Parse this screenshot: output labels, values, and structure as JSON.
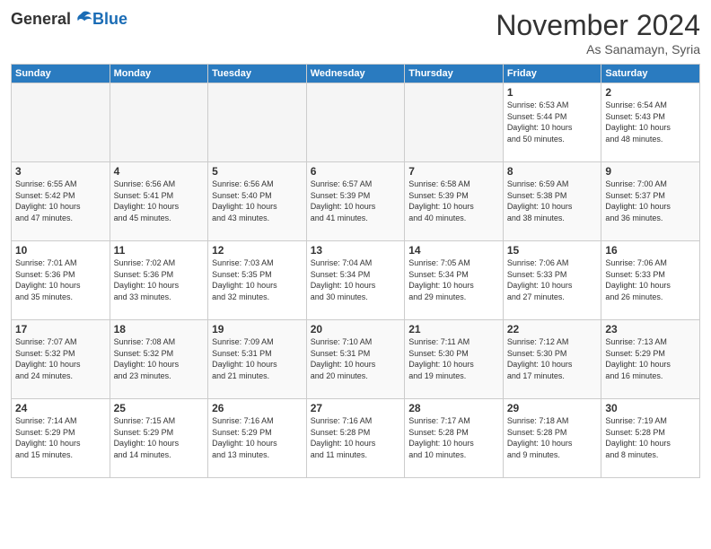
{
  "header": {
    "logo_general": "General",
    "logo_blue": "Blue",
    "month_title": "November 2024",
    "location": "As Sanamayn, Syria"
  },
  "days_of_week": [
    "Sunday",
    "Monday",
    "Tuesday",
    "Wednesday",
    "Thursday",
    "Friday",
    "Saturday"
  ],
  "weeks": [
    [
      {
        "day": "",
        "info": ""
      },
      {
        "day": "",
        "info": ""
      },
      {
        "day": "",
        "info": ""
      },
      {
        "day": "",
        "info": ""
      },
      {
        "day": "",
        "info": ""
      },
      {
        "day": "1",
        "info": "Sunrise: 6:53 AM\nSunset: 5:44 PM\nDaylight: 10 hours\nand 50 minutes."
      },
      {
        "day": "2",
        "info": "Sunrise: 6:54 AM\nSunset: 5:43 PM\nDaylight: 10 hours\nand 48 minutes."
      }
    ],
    [
      {
        "day": "3",
        "info": "Sunrise: 6:55 AM\nSunset: 5:42 PM\nDaylight: 10 hours\nand 47 minutes."
      },
      {
        "day": "4",
        "info": "Sunrise: 6:56 AM\nSunset: 5:41 PM\nDaylight: 10 hours\nand 45 minutes."
      },
      {
        "day": "5",
        "info": "Sunrise: 6:56 AM\nSunset: 5:40 PM\nDaylight: 10 hours\nand 43 minutes."
      },
      {
        "day": "6",
        "info": "Sunrise: 6:57 AM\nSunset: 5:39 PM\nDaylight: 10 hours\nand 41 minutes."
      },
      {
        "day": "7",
        "info": "Sunrise: 6:58 AM\nSunset: 5:39 PM\nDaylight: 10 hours\nand 40 minutes."
      },
      {
        "day": "8",
        "info": "Sunrise: 6:59 AM\nSunset: 5:38 PM\nDaylight: 10 hours\nand 38 minutes."
      },
      {
        "day": "9",
        "info": "Sunrise: 7:00 AM\nSunset: 5:37 PM\nDaylight: 10 hours\nand 36 minutes."
      }
    ],
    [
      {
        "day": "10",
        "info": "Sunrise: 7:01 AM\nSunset: 5:36 PM\nDaylight: 10 hours\nand 35 minutes."
      },
      {
        "day": "11",
        "info": "Sunrise: 7:02 AM\nSunset: 5:36 PM\nDaylight: 10 hours\nand 33 minutes."
      },
      {
        "day": "12",
        "info": "Sunrise: 7:03 AM\nSunset: 5:35 PM\nDaylight: 10 hours\nand 32 minutes."
      },
      {
        "day": "13",
        "info": "Sunrise: 7:04 AM\nSunset: 5:34 PM\nDaylight: 10 hours\nand 30 minutes."
      },
      {
        "day": "14",
        "info": "Sunrise: 7:05 AM\nSunset: 5:34 PM\nDaylight: 10 hours\nand 29 minutes."
      },
      {
        "day": "15",
        "info": "Sunrise: 7:06 AM\nSunset: 5:33 PM\nDaylight: 10 hours\nand 27 minutes."
      },
      {
        "day": "16",
        "info": "Sunrise: 7:06 AM\nSunset: 5:33 PM\nDaylight: 10 hours\nand 26 minutes."
      }
    ],
    [
      {
        "day": "17",
        "info": "Sunrise: 7:07 AM\nSunset: 5:32 PM\nDaylight: 10 hours\nand 24 minutes."
      },
      {
        "day": "18",
        "info": "Sunrise: 7:08 AM\nSunset: 5:32 PM\nDaylight: 10 hours\nand 23 minutes."
      },
      {
        "day": "19",
        "info": "Sunrise: 7:09 AM\nSunset: 5:31 PM\nDaylight: 10 hours\nand 21 minutes."
      },
      {
        "day": "20",
        "info": "Sunrise: 7:10 AM\nSunset: 5:31 PM\nDaylight: 10 hours\nand 20 minutes."
      },
      {
        "day": "21",
        "info": "Sunrise: 7:11 AM\nSunset: 5:30 PM\nDaylight: 10 hours\nand 19 minutes."
      },
      {
        "day": "22",
        "info": "Sunrise: 7:12 AM\nSunset: 5:30 PM\nDaylight: 10 hours\nand 17 minutes."
      },
      {
        "day": "23",
        "info": "Sunrise: 7:13 AM\nSunset: 5:29 PM\nDaylight: 10 hours\nand 16 minutes."
      }
    ],
    [
      {
        "day": "24",
        "info": "Sunrise: 7:14 AM\nSunset: 5:29 PM\nDaylight: 10 hours\nand 15 minutes."
      },
      {
        "day": "25",
        "info": "Sunrise: 7:15 AM\nSunset: 5:29 PM\nDaylight: 10 hours\nand 14 minutes."
      },
      {
        "day": "26",
        "info": "Sunrise: 7:16 AM\nSunset: 5:29 PM\nDaylight: 10 hours\nand 13 minutes."
      },
      {
        "day": "27",
        "info": "Sunrise: 7:16 AM\nSunset: 5:28 PM\nDaylight: 10 hours\nand 11 minutes."
      },
      {
        "day": "28",
        "info": "Sunrise: 7:17 AM\nSunset: 5:28 PM\nDaylight: 10 hours\nand 10 minutes."
      },
      {
        "day": "29",
        "info": "Sunrise: 7:18 AM\nSunset: 5:28 PM\nDaylight: 10 hours\nand 9 minutes."
      },
      {
        "day": "30",
        "info": "Sunrise: 7:19 AM\nSunset: 5:28 PM\nDaylight: 10 hours\nand 8 minutes."
      }
    ]
  ]
}
